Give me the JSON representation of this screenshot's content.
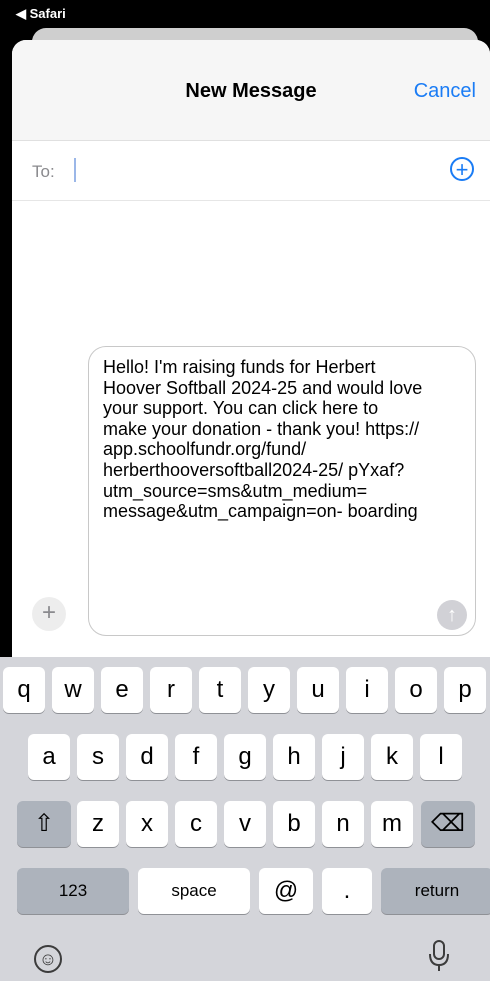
{
  "status_bar": {
    "back_label": "◀ Safari"
  },
  "header": {
    "title": "New Message",
    "cancel_label": "Cancel"
  },
  "recipient": {
    "to_label": "To:",
    "add_icon": "plus-circle-icon"
  },
  "compose": {
    "message_text": "Hello! I'm raising funds for Herbert Hoover Softball 2024-25 and would love your support. You can click here to make your donation - thank you! https:// app.schoolfundr.org/fund/ herberthooversoftball2024-25/ pYxaf? utm_source=sms&utm_medium= message&utm_campaign=on- boarding",
    "attach_icon": "plus-icon",
    "send_icon": "arrow-up-icon"
  },
  "keyboard": {
    "row1": [
      "q",
      "w",
      "e",
      "r",
      "t",
      "y",
      "u",
      "i",
      "o",
      "p"
    ],
    "row2": [
      "a",
      "s",
      "d",
      "f",
      "g",
      "h",
      "j",
      "k",
      "l"
    ],
    "row3": [
      "z",
      "x",
      "c",
      "v",
      "b",
      "n",
      "m"
    ],
    "shift_icon": "shift-icon",
    "delete_icon": "delete-icon",
    "numbers_label": "123",
    "space_label": "space",
    "at_label": "@",
    "period_label": ".",
    "return_label": "return",
    "emoji_icon": "emoji-icon",
    "mic_icon": "microphone-icon"
  }
}
